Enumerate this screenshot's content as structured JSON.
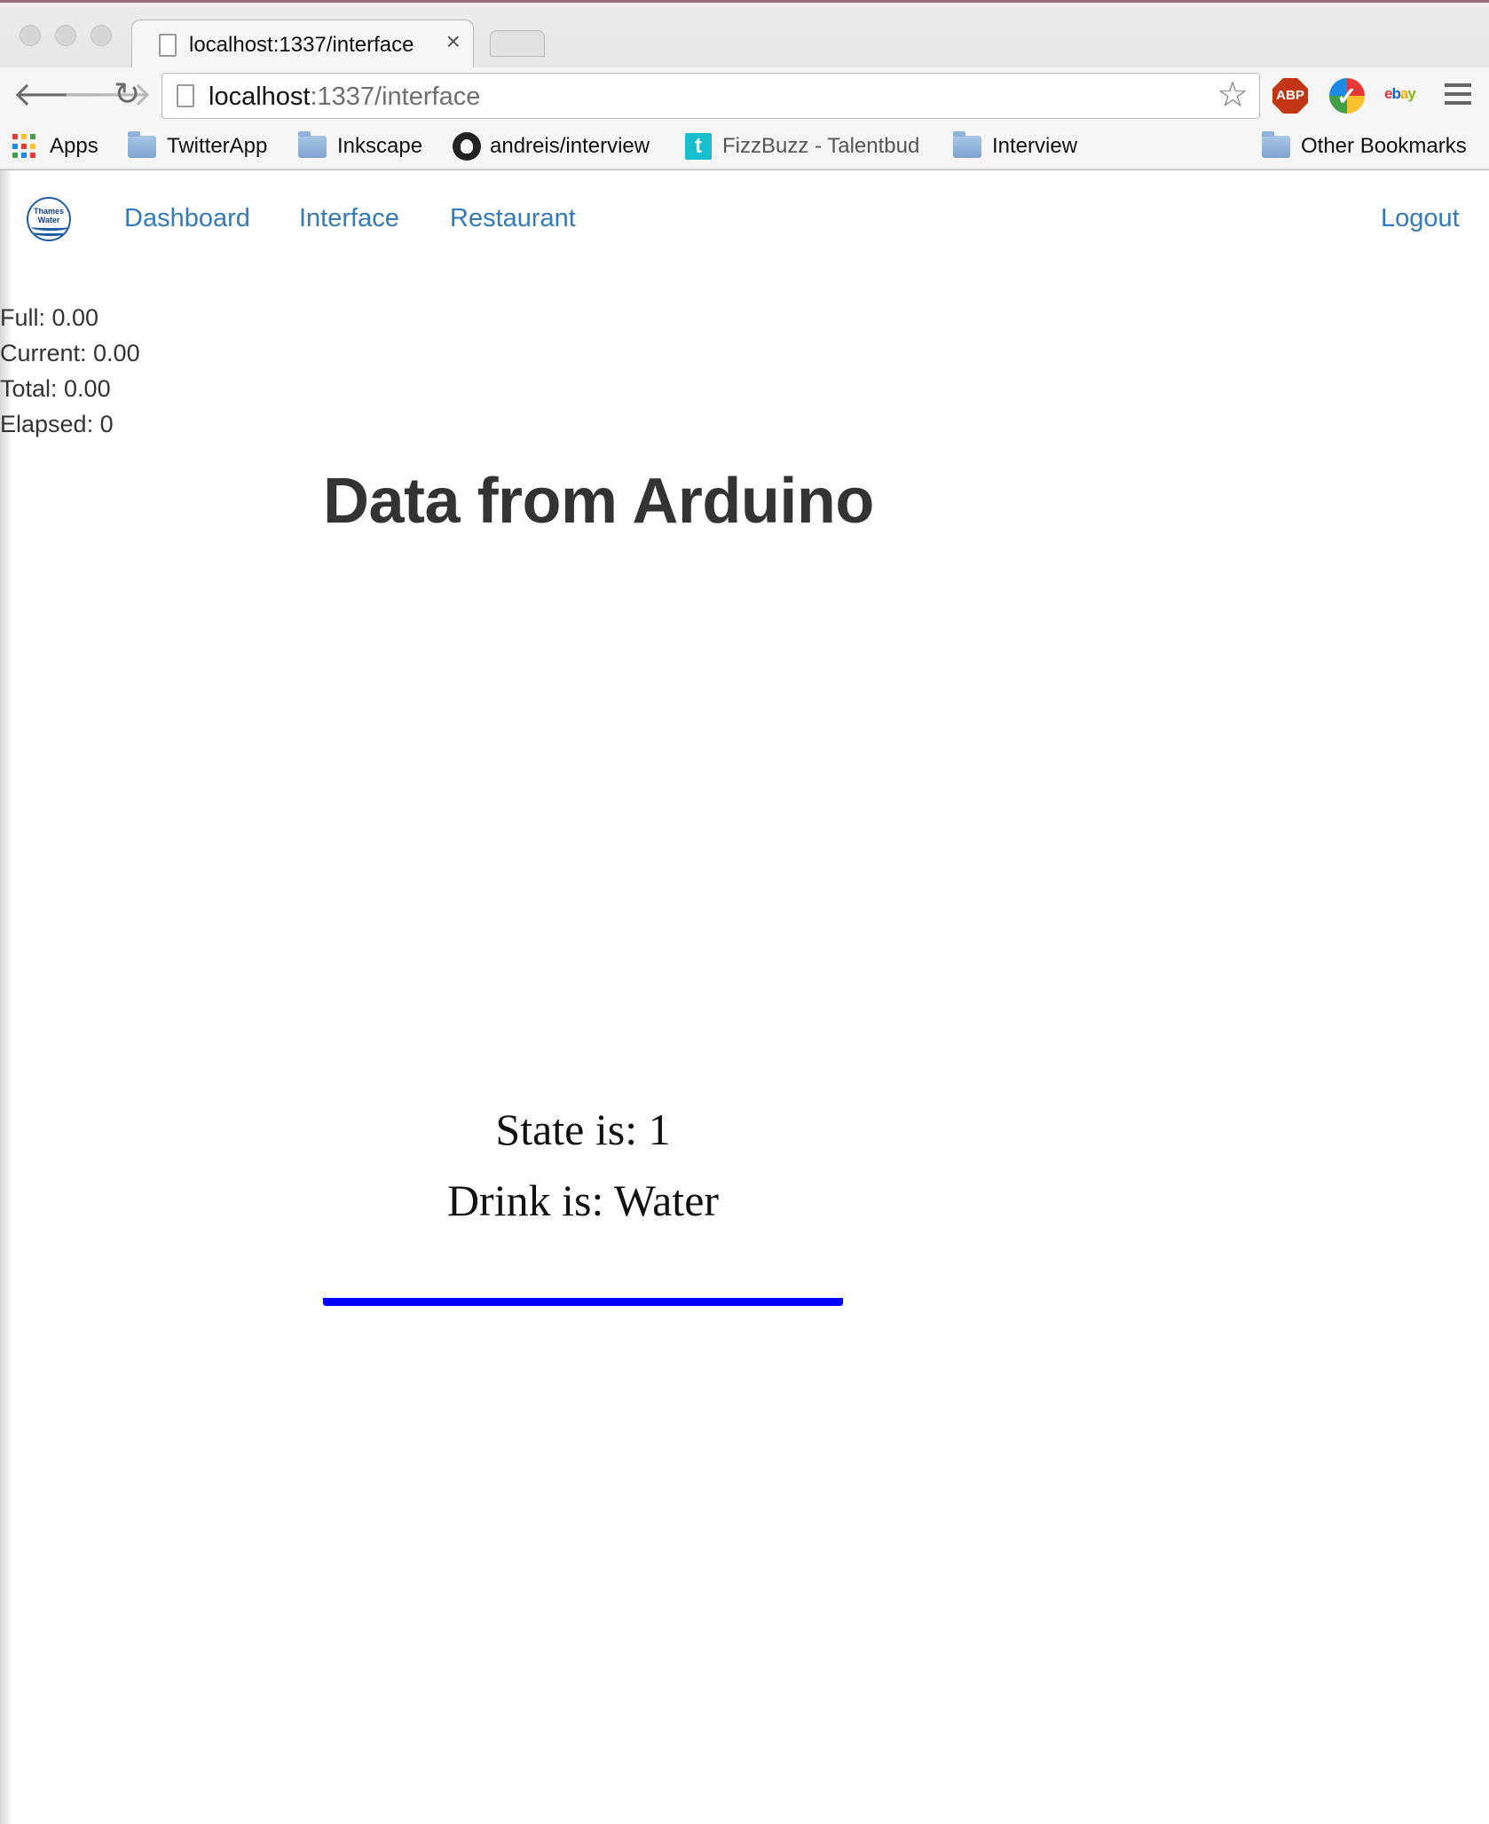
{
  "browser": {
    "tab_title": "localhost:1337/interface",
    "tab_close_glyph": "×",
    "url_host": "localhost",
    "url_path": ":1337/interface",
    "extensions": [
      "adblock-plus-icon",
      "checkmark-extension-icon",
      "ebay-icon"
    ],
    "bookmarks": [
      {
        "label": "Apps",
        "icon": "apps-grid-icon"
      },
      {
        "label": "TwitterApp",
        "icon": "folder-icon"
      },
      {
        "label": "Inkscape",
        "icon": "folder-icon"
      },
      {
        "label": "andreis/interview",
        "icon": "github-icon"
      },
      {
        "label": "FizzBuzz - Talentbud",
        "icon": "talentbuddy-icon"
      },
      {
        "label": "Interview",
        "icon": "folder-icon"
      },
      {
        "label": "Other Bookmarks",
        "icon": "folder-icon"
      }
    ],
    "ext_abp_label": "ABP",
    "ext_ebay_label": "ebay"
  },
  "navbar": {
    "logo_text_1": "Thames",
    "logo_text_2": "Water",
    "links": [
      {
        "label": "Dashboard"
      },
      {
        "label": "Interface"
      },
      {
        "label": "Restaurant"
      }
    ],
    "logout_label": "Logout",
    "link_color": "#337ab7"
  },
  "stats": {
    "full": "Full: 0.00",
    "current": "Current: 0.00",
    "total": "Total: 0.00",
    "elapsed": "Elapsed: 0"
  },
  "main": {
    "heading": "Data from Arduino",
    "state_text": "State is: 1",
    "drink_text": "Drink is: Water",
    "level_bar_color": "#0000ff"
  }
}
